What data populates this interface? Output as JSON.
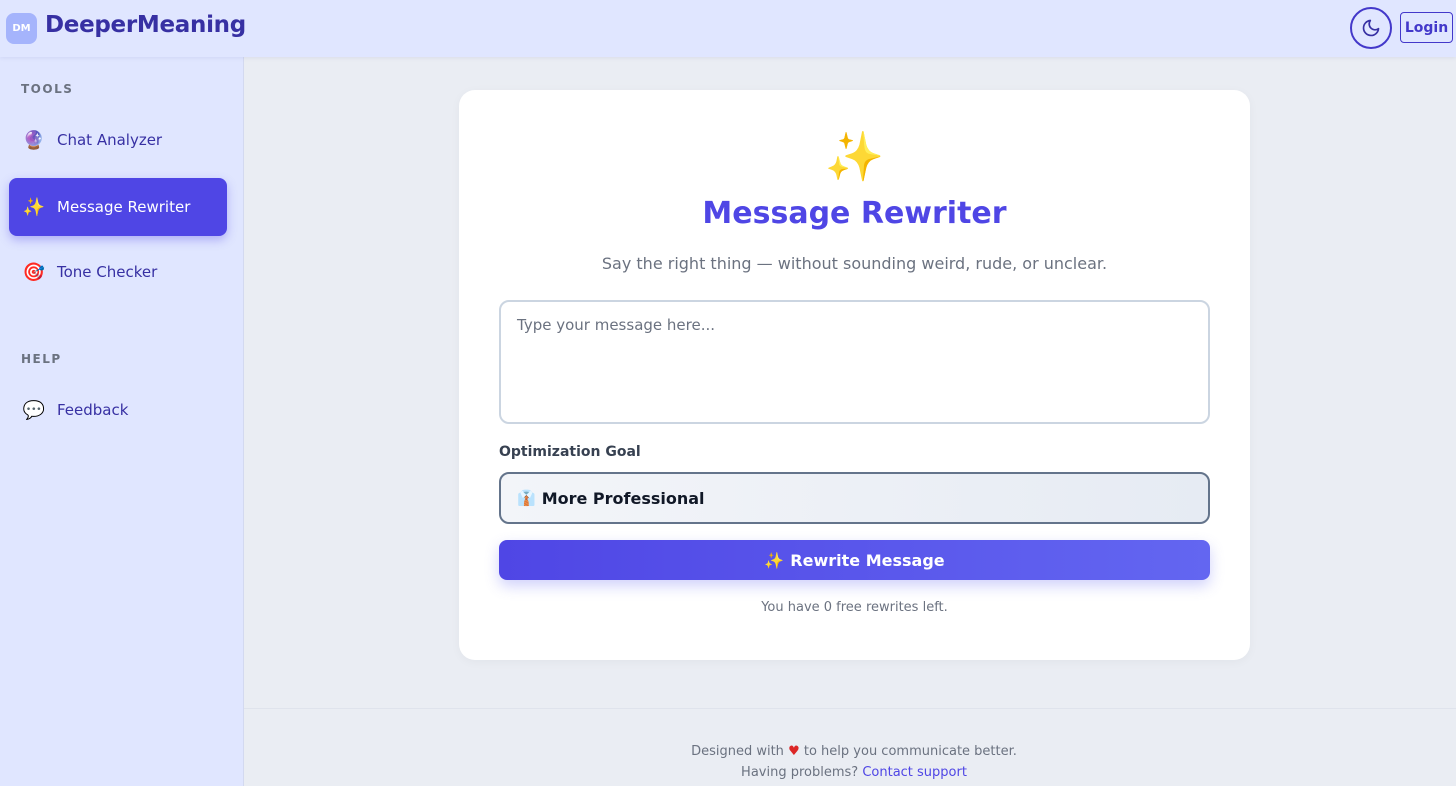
{
  "header": {
    "logo_text": "DM",
    "brand": "DeeperMeaning",
    "theme_toggle_icon": "moon-icon",
    "login_label": "Login"
  },
  "sidebar": {
    "tools_label": "TOOLS",
    "help_label": "HELP",
    "items": [
      {
        "emoji": "🔮",
        "label": "Chat Analyzer",
        "active": false
      },
      {
        "emoji": "✨",
        "label": "Message Rewriter",
        "active": true
      },
      {
        "emoji": "🎯",
        "label": "Tone Checker",
        "active": false
      }
    ],
    "help_items": [
      {
        "emoji": "💬",
        "label": "Feedback"
      }
    ]
  },
  "main": {
    "hero_emoji": "✨",
    "title": "Message Rewriter",
    "subtitle": "Say the right thing — without sounding weird, rude, or unclear.",
    "message_input": {
      "value": "",
      "placeholder": "Type your message here..."
    },
    "goal_label": "Optimization Goal",
    "goal_select": {
      "emoji": "👔",
      "value": "More Professional"
    },
    "rewrite_button": {
      "emoji": "✨",
      "label": "Rewrite Message"
    },
    "free_note": "You have 0 free rewrites left."
  },
  "footer": {
    "line1_before": "Designed with",
    "heart": "♥",
    "line1_after": "to help you communicate better.",
    "line2_before": "Having problems?",
    "support_link": "Contact support"
  },
  "colors": {
    "accent": "#4f46e5",
    "brand": "#3730a3",
    "sidebar_bg": "#e0e6ff",
    "page_bg": "#eaedf3"
  }
}
